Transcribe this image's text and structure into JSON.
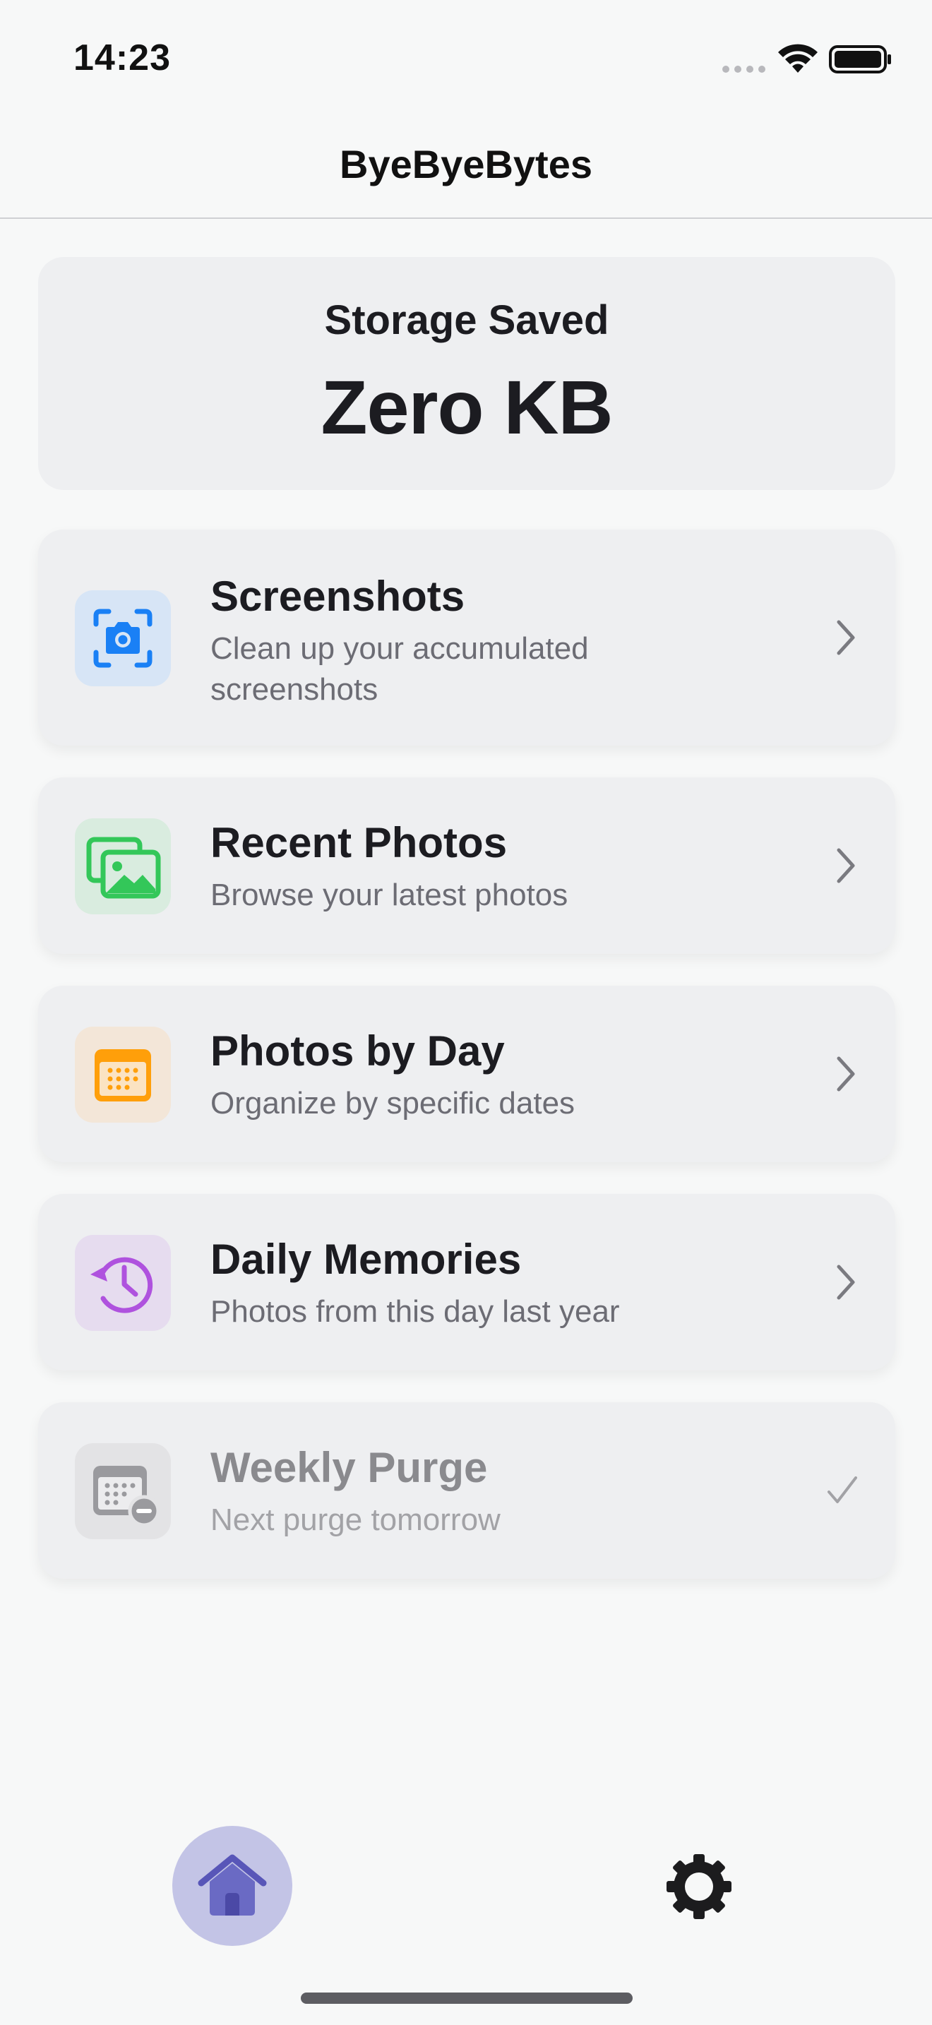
{
  "status_bar": {
    "time": "14:23"
  },
  "header": {
    "title": "ByeByeBytes"
  },
  "storage": {
    "label": "Storage Saved",
    "value": "Zero KB"
  },
  "menu": {
    "items": [
      {
        "title": "Screenshots",
        "subtitle": "Clean up your accumulated screenshots",
        "icon": "camera-viewfinder-icon",
        "icon_color": "#1a80f5",
        "icon_bg": "#d7e5f6",
        "trailing": "chevron-right-icon",
        "enabled": true
      },
      {
        "title": "Recent Photos",
        "subtitle": "Browse your latest photos",
        "icon": "photos-stack-icon",
        "icon_color": "#33c759",
        "icon_bg": "#d9ecdf",
        "trailing": "chevron-right-icon",
        "enabled": true
      },
      {
        "title": "Photos by Day",
        "subtitle": "Organize by specific dates",
        "icon": "calendar-icon",
        "icon_color": "#ff9f0a",
        "icon_bg": "#f3e6d8",
        "trailing": "chevron-right-icon",
        "enabled": true
      },
      {
        "title": "Daily Memories",
        "subtitle": "Photos from this day last year",
        "icon": "clock-history-icon",
        "icon_color": "#af52de",
        "icon_bg": "#e6dcef",
        "trailing": "chevron-right-icon",
        "enabled": true
      },
      {
        "title": "Weekly Purge",
        "subtitle": "Next purge tomorrow",
        "icon": "calendar-minus-icon",
        "icon_color": "#9a9a9e",
        "icon_bg": "#e3e3e5",
        "trailing": "checkmark-icon",
        "enabled": false
      }
    ]
  },
  "tab_bar": {
    "tabs": [
      {
        "name": "home",
        "icon": "house-icon",
        "selected": true,
        "color": "#5856b8"
      },
      {
        "name": "settings",
        "icon": "gear-icon",
        "selected": false,
        "color": "#1c1c1e"
      }
    ]
  },
  "colors": {
    "background": "#f7f8f8",
    "card": "#eeeff1",
    "accent": "#5856b8"
  }
}
